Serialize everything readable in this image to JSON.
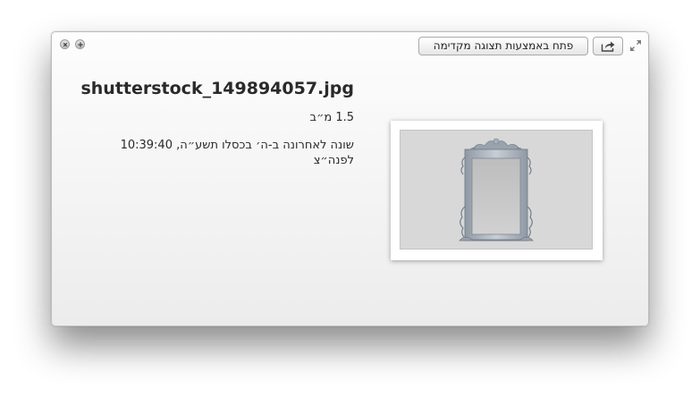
{
  "window": {
    "controls": {
      "close": "close-icon",
      "zoom": "plus-icon"
    },
    "toolbar": {
      "open_with_preview_label": "פתח באמצעות תצוגה מקדימה",
      "share_icon": "share-icon",
      "fullscreen_icon": "expand-icon"
    }
  },
  "file": {
    "name": "shutterstock_149894057.jpg",
    "size": "1.5 מ״ב",
    "modified": "שונה לאחרונה ב-ה׳ בכסלו תשע״ה, 10:39:40 לפנה״צ"
  },
  "thumbnail": {
    "description_icon": "ornate-frame-image",
    "background_color": "#d8d8d8",
    "frame_color": "#9aa3ad"
  }
}
